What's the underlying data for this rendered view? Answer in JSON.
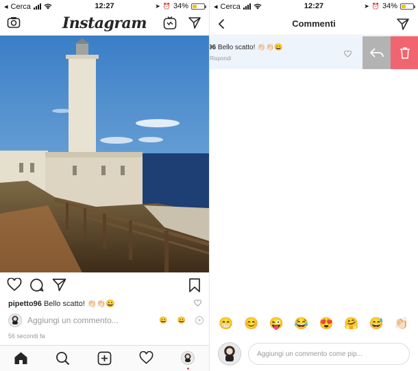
{
  "left": {
    "status": {
      "carrier": "Cerca",
      "time": "12:27",
      "battery": "34%",
      "battery_level": 0.34
    },
    "header": {
      "logo": "Instagram"
    },
    "post": {
      "caption_user": "pipetto96",
      "caption_text": "Bello scatto! 👏🏻👏🏻😀",
      "comment_placeholder": "Aggiungi un commento...",
      "emoji_1": "😀",
      "emoji_2": "😀",
      "timestamp": "56 secondi fa"
    }
  },
  "right": {
    "status": {
      "carrier": "Cerca",
      "time": "12:27",
      "battery": "34%",
      "battery_level": 0.34
    },
    "header": {
      "title": "Commenti"
    },
    "comment": {
      "user_fragment": "96",
      "text": "Bello scatto! 👏🏻👏🏻😀",
      "reply_label": "Rispondi"
    },
    "emoji_bar": [
      "😁",
      "😊",
      "😜",
      "😂",
      "😍",
      "🤗",
      "😅",
      "👏🏻"
    ],
    "input": {
      "placeholder": "Aggiungi un commento come pip..."
    }
  }
}
